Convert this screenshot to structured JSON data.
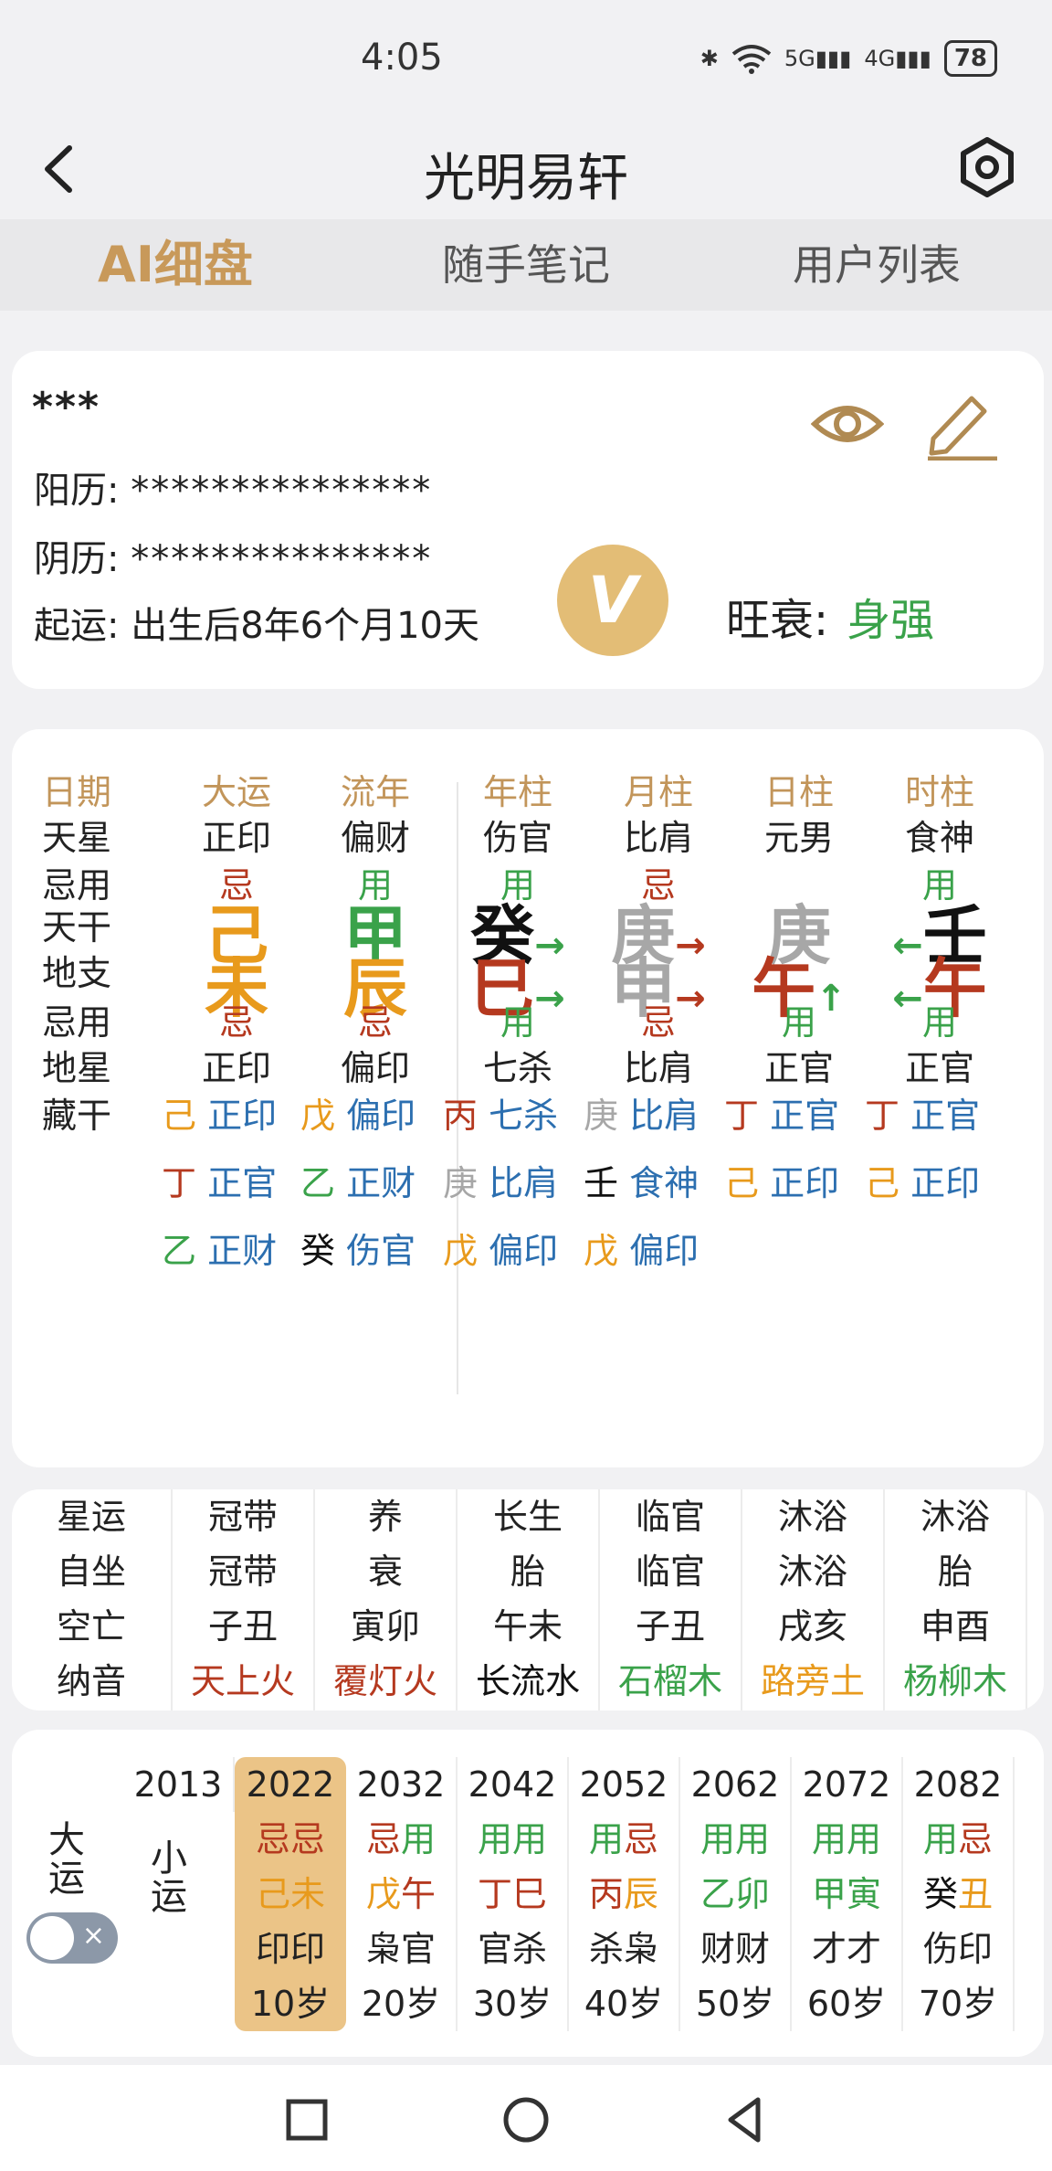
{
  "status_bar": {
    "time": "4:05",
    "network": "5G",
    "network2": "4G",
    "battery": "78"
  },
  "header": {
    "title": "光明易轩",
    "back_icon": "back-chevron-icon",
    "settings_icon": "hexagon-settings-icon"
  },
  "tabs": [
    {
      "label": "AI细盘",
      "active": true
    },
    {
      "label": "随手笔记"
    },
    {
      "label": "用户列表"
    }
  ],
  "profile": {
    "name": "***",
    "solar_label": "阳历:",
    "solar_value": "***************",
    "lunar_label": "阴历:",
    "lunar_value": "***************",
    "luck_label": "起运:",
    "luck_value": "出生后8年6个月10天",
    "vip_badge": "V",
    "strength_label": "旺衰:",
    "strength_value": "身强"
  },
  "pillars": {
    "row_labels": [
      "天星",
      "忌用",
      "天干",
      "地支",
      "忌用",
      "地星",
      "藏干"
    ],
    "first_header": "日期",
    "columns": [
      {
        "header": "大运",
        "star": "正印",
        "use1": "忌",
        "gan": "己",
        "zhi": "未",
        "use2": "忌",
        "dstar": "正印",
        "hidden": [
          [
            "己",
            "正印"
          ],
          [
            "丁",
            "正官"
          ],
          [
            "乙",
            "正财"
          ]
        ]
      },
      {
        "header": "流年",
        "star": "偏财",
        "use1": "用",
        "gan": "甲",
        "zhi": "辰",
        "use2": "忌",
        "dstar": "偏印",
        "hidden": [
          [
            "戊",
            "偏印"
          ],
          [
            "乙",
            "正财"
          ],
          [
            "癸",
            "伤官"
          ]
        ]
      },
      {
        "header": "年柱",
        "star": "伤官",
        "use1": "用",
        "gan": "癸",
        "zhi": "巳",
        "use2": "用",
        "dstar": "七杀",
        "gan_arrow": "→",
        "zhi_arrow": "→",
        "hidden": [
          [
            "丙",
            "七杀"
          ],
          [
            "庚",
            "比肩"
          ],
          [
            "戊",
            "偏印"
          ]
        ]
      },
      {
        "header": "月柱",
        "star": "比肩",
        "use1": "忌",
        "gan": "庚",
        "zhi": "申",
        "use2": "忌",
        "dstar": "比肩",
        "gan_arrow": "→",
        "zhi_arrow": "→",
        "hidden": [
          [
            "庚",
            "比肩"
          ],
          [
            "壬",
            "食神"
          ],
          [
            "戊",
            "偏印"
          ]
        ]
      },
      {
        "header": "日柱",
        "star": "元男",
        "use1": "",
        "gan": "庚",
        "zhi": "午",
        "use2": "用",
        "dstar": "正官",
        "zhi_arrow": "↑",
        "hidden": [
          [
            "丁",
            "正官"
          ],
          [
            "己",
            "正印"
          ]
        ]
      },
      {
        "header": "时柱",
        "star": "食神",
        "use1": "用",
        "gan": "壬",
        "zhi": "午",
        "use2": "用",
        "dstar": "正官",
        "gan_arrow_left": "←",
        "zhi_arrow_left": "←",
        "hidden": [
          [
            "丁",
            "正官"
          ],
          [
            "己",
            "正印"
          ]
        ]
      }
    ]
  },
  "stars_table": {
    "labels": [
      "星运",
      "自坐",
      "空亡",
      "纳音"
    ],
    "columns": [
      [
        "冠带",
        "冠带",
        "子丑",
        "天上火"
      ],
      [
        "养",
        "衰",
        "寅卯",
        "覆灯火"
      ],
      [
        "长生",
        "胎",
        "午未",
        "长流水"
      ],
      [
        "临官",
        "临官",
        "子丑",
        "石榴木"
      ],
      [
        "沐浴",
        "沐浴",
        "戌亥",
        "路旁土"
      ],
      [
        "沐浴",
        "胎",
        "申酉",
        "杨柳木"
      ]
    ]
  },
  "dayun": {
    "label_big": "大运",
    "label_small": "小运",
    "first_year": "2013",
    "columns": [
      {
        "year": "2022",
        "use": [
          "忌",
          "忌"
        ],
        "gz": [
          "己",
          "未"
        ],
        "god": "印印",
        "age": "10岁",
        "active": true
      },
      {
        "year": "2032",
        "use": [
          "忌",
          "用"
        ],
        "gz": [
          "戊",
          "午"
        ],
        "god": "枭官",
        "age": "20岁"
      },
      {
        "year": "2042",
        "use": [
          "用",
          "用"
        ],
        "gz": [
          "丁",
          "巳"
        ],
        "god": "官杀",
        "age": "30岁"
      },
      {
        "year": "2052",
        "use": [
          "用",
          "忌"
        ],
        "gz": [
          "丙",
          "辰"
        ],
        "god": "杀枭",
        "age": "40岁"
      },
      {
        "year": "2062",
        "use": [
          "用",
          "用"
        ],
        "gz": [
          "乙",
          "卯"
        ],
        "god": "财财",
        "age": "50岁"
      },
      {
        "year": "2072",
        "use": [
          "用",
          "用"
        ],
        "gz": [
          "甲",
          "寅"
        ],
        "god": "才才",
        "age": "60岁"
      },
      {
        "year": "2082",
        "use": [
          "用",
          "忌"
        ],
        "gz": [
          "癸",
          "丑"
        ],
        "god": "伤印",
        "age": "70岁"
      }
    ],
    "toggle_symbol": "×"
  },
  "colors": {
    "gold": "#c8995a",
    "ji": "#b5391f",
    "yong": "#3aa24a",
    "earth": "#e89a1c",
    "wood": "#3aa24a",
    "fire": "#b5391f",
    "metal": "#a7a7a7",
    "water": "#111111",
    "blue": "#2c6fb0"
  }
}
